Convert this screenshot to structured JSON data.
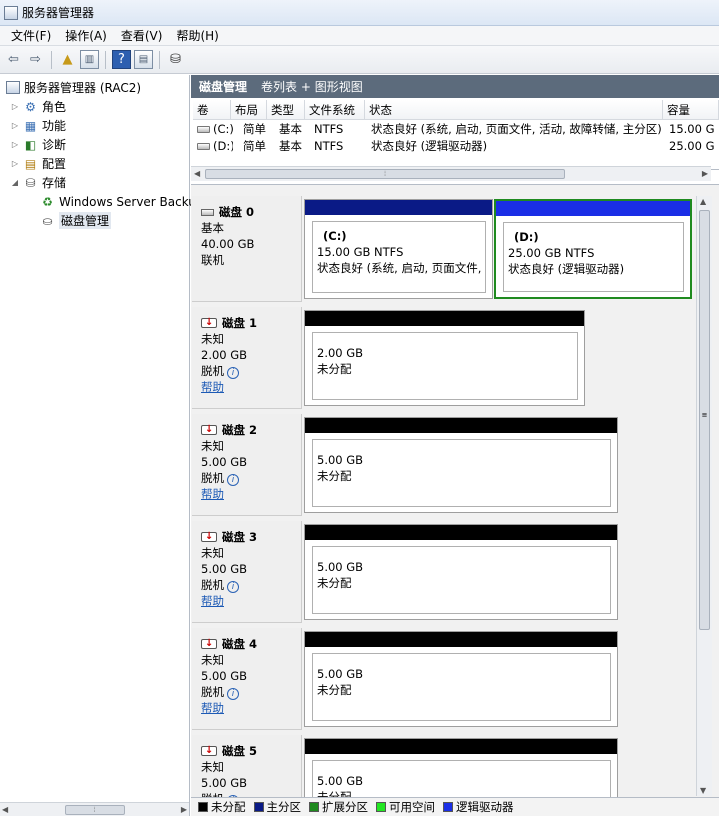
{
  "window": {
    "title": "服务器管理器"
  },
  "menu": [
    "文件(F)",
    "操作(A)",
    "查看(V)",
    "帮助(H)"
  ],
  "tree": {
    "root": "服务器管理器 (RAC2)",
    "items": [
      {
        "label": "角色",
        "icon": "roles-icon"
      },
      {
        "label": "功能",
        "icon": "features-icon"
      },
      {
        "label": "诊断",
        "icon": "diagnostics-icon"
      },
      {
        "label": "配置",
        "icon": "configuration-icon"
      },
      {
        "label": "存储",
        "icon": "storage-icon"
      }
    ],
    "storage_children": [
      {
        "label": "Windows Server Backu",
        "icon": "backup-icon"
      },
      {
        "label": "磁盘管理",
        "icon": "disk-management-icon"
      }
    ]
  },
  "panel": {
    "title": "磁盘管理",
    "subtitle": "卷列表 + 图形视图"
  },
  "volumes": {
    "columns": [
      "卷",
      "布局",
      "类型",
      "文件系统",
      "状态",
      "容量"
    ],
    "rows": [
      {
        "volume": "(C:)",
        "layout": "简单",
        "type": "基本",
        "fs": "NTFS",
        "status": "状态良好 (系统, 启动, 页面文件, 活动, 故障转储, 主分区)",
        "capacity": "15.00 G"
      },
      {
        "volume": "(D:)",
        "layout": "简单",
        "type": "基本",
        "fs": "NTFS",
        "status": "状态良好 (逻辑驱动器)",
        "capacity": "25.00 G"
      }
    ]
  },
  "disks": [
    {
      "name": "磁盘 0",
      "kind": "基本",
      "size": "40.00 GB",
      "state": "联机",
      "help": "",
      "offline": false,
      "partitions": [
        {
          "title": "(C:)",
          "size": "15.00 GB NTFS",
          "status": "状态良好 (系统, 启动, 页面文件, 活",
          "bar": "#0a1a86",
          "selected": false
        },
        {
          "title": "(D:)",
          "size": "25.00 GB NTFS",
          "status": "状态良好 (逻辑驱动器)",
          "bar": "#1a2ee6",
          "selected": true
        }
      ]
    },
    {
      "name": "磁盘 1",
      "kind": "未知",
      "size": "2.00 GB",
      "state": "脱机",
      "help": "帮助",
      "offline": true,
      "partitions": [
        {
          "title": "",
          "size": "2.00 GB",
          "status": "未分配",
          "bar": "#000000",
          "selected": false
        }
      ]
    },
    {
      "name": "磁盘 2",
      "kind": "未知",
      "size": "5.00 GB",
      "state": "脱机",
      "help": "帮助",
      "offline": true,
      "partitions": [
        {
          "title": "",
          "size": "5.00 GB",
          "status": "未分配",
          "bar": "#000000",
          "selected": false
        }
      ]
    },
    {
      "name": "磁盘 3",
      "kind": "未知",
      "size": "5.00 GB",
      "state": "脱机",
      "help": "帮助",
      "offline": true,
      "partitions": [
        {
          "title": "",
          "size": "5.00 GB",
          "status": "未分配",
          "bar": "#000000",
          "selected": false
        }
      ]
    },
    {
      "name": "磁盘 4",
      "kind": "未知",
      "size": "5.00 GB",
      "state": "脱机",
      "help": "帮助",
      "offline": true,
      "partitions": [
        {
          "title": "",
          "size": "5.00 GB",
          "status": "未分配",
          "bar": "#000000",
          "selected": false
        }
      ]
    },
    {
      "name": "磁盘 5",
      "kind": "未知",
      "size": "5.00 GB",
      "state": "脱机",
      "help": "",
      "offline": true,
      "partitions": [
        {
          "title": "",
          "size": "5.00 GB",
          "status": "未分配",
          "bar": "#000000",
          "selected": false
        }
      ]
    }
  ],
  "legend": [
    {
      "label": "未分配",
      "color": "#000000"
    },
    {
      "label": "主分区",
      "color": "#0a1a86"
    },
    {
      "label": "扩展分区",
      "color": "#1f8a1f"
    },
    {
      "label": "可用空间",
      "color": "#22e622"
    },
    {
      "label": "逻辑驱动器",
      "color": "#1a2ee6"
    }
  ]
}
